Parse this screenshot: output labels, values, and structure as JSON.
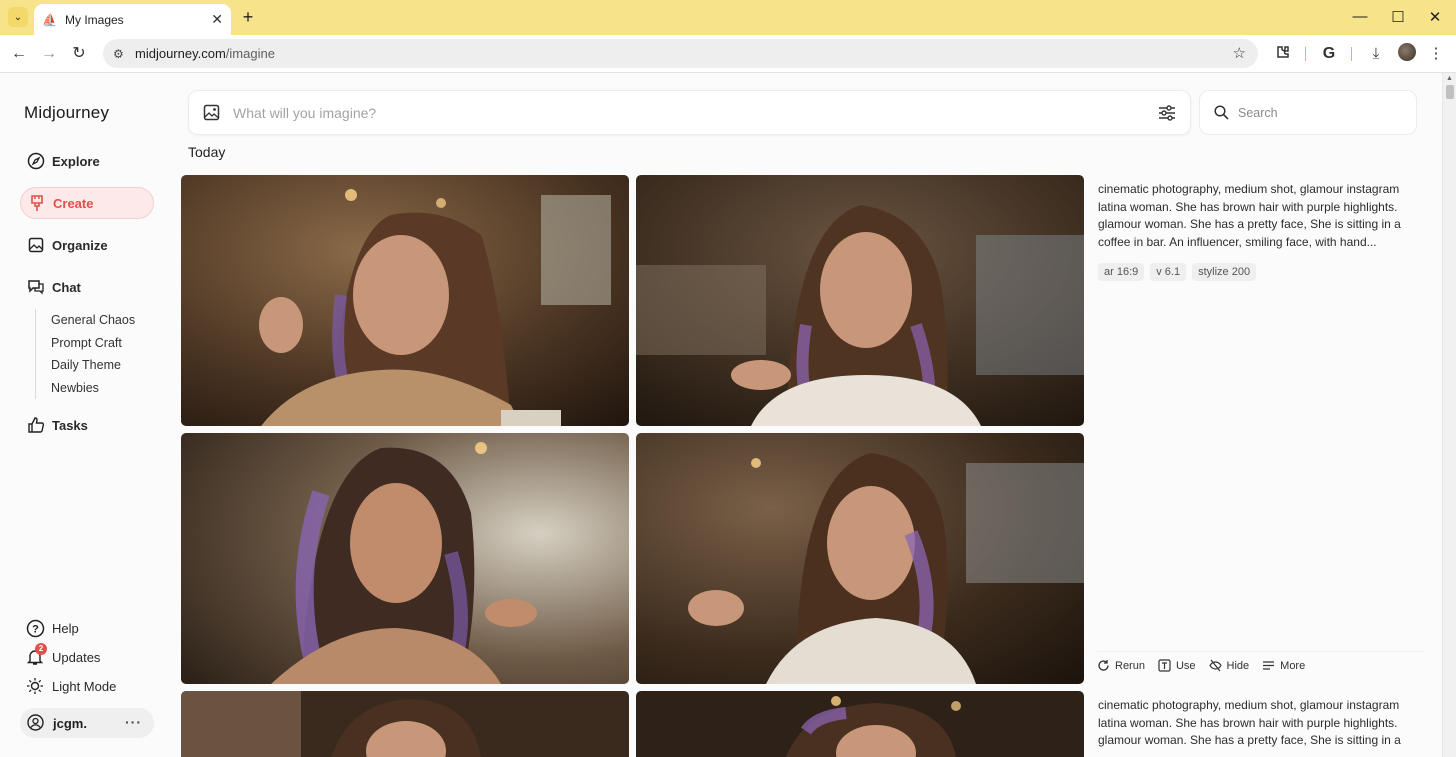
{
  "browser": {
    "tab_title": "My Images",
    "url_host": "midjourney.com",
    "url_path": "/imagine",
    "accent_color": "#f6e38a"
  },
  "sidebar": {
    "brand": "Midjourney",
    "items": [
      {
        "label": "Explore",
        "icon": "compass-icon"
      },
      {
        "label": "Create",
        "icon": "brush-icon",
        "active": true
      },
      {
        "label": "Organize",
        "icon": "image-icon"
      },
      {
        "label": "Chat",
        "icon": "chat-icon"
      },
      {
        "label": "Tasks",
        "icon": "thumbs-up-icon"
      }
    ],
    "chat_channels": [
      "General Chaos",
      "Prompt Craft",
      "Daily Theme",
      "Newbies"
    ],
    "bottom": {
      "help": "Help",
      "updates": "Updates",
      "updates_count": "2",
      "light_mode": "Light Mode",
      "username": "jcgm.",
      "more": "···"
    },
    "active_color": "#e2504c"
  },
  "imagine": {
    "placeholder": "What will you imagine?"
  },
  "search": {
    "placeholder": "Search"
  },
  "feed": {
    "section_label": "Today",
    "groups": [
      {
        "prompt": "cinematic photography, medium shot, glamour instagram latina woman. She has brown hair with purple highlights. glamour woman. She has a pretty face, She is sitting in a coffee in bar. An influencer, smiling face, with hand...",
        "tags": [
          "ar 16:9",
          "v 6.1",
          "stylize 200"
        ],
        "actions": [
          "Rerun",
          "Use",
          "Hide",
          "More"
        ]
      },
      {
        "prompt": "cinematic photography, medium shot, glamour instagram latina woman. She has brown hair with purple highlights. glamour woman. She has a pretty face, She is sitting in a"
      }
    ]
  }
}
